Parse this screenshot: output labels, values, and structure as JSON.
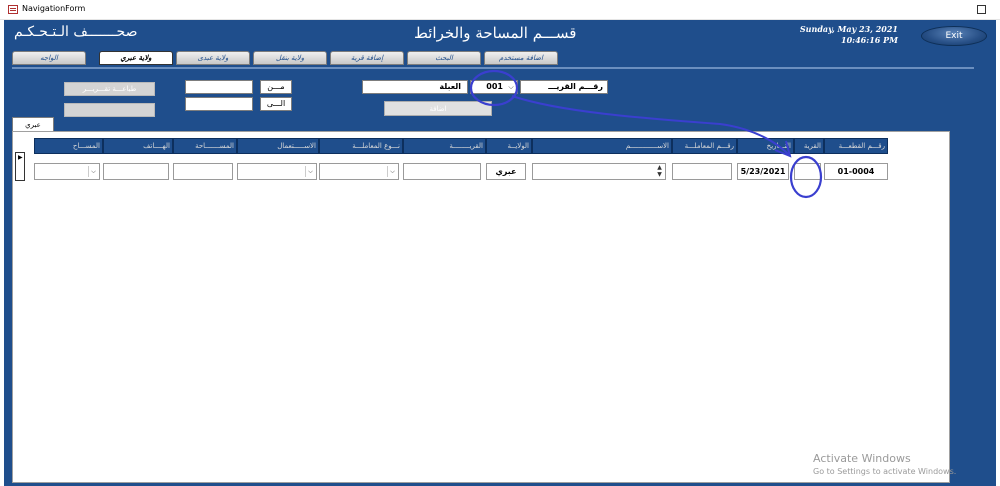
{
  "window": {
    "title": "NavigationForm"
  },
  "header": {
    "main_title": "قســـم المساحة والخرائط",
    "panel_title": "صحـــــــف الـتـحـكـم",
    "date": "Sunday, May 23, 2021",
    "time": "10:46:16 PM",
    "exit_label": "Exit"
  },
  "nav_tabs": [
    {
      "label": "اضافة مستخدم"
    },
    {
      "label": "البحث"
    },
    {
      "label": "إضافة قرية"
    },
    {
      "label": "ولاية بنقل"
    },
    {
      "label": "ولاية عبدى"
    },
    {
      "label": "ولاية عبري",
      "active": true
    },
    {
      "label": "الواجه"
    }
  ],
  "filter": {
    "plot_label": "رقـــم القريـــ",
    "village_code": "001",
    "village_name": "العبلة",
    "from_label": "مـــن",
    "to_label": "الـــى",
    "print_button": "طباعـــة تقـــريـــر",
    "add_button": "اضافة"
  },
  "subform_tab": "عبري",
  "columns": [
    {
      "label": "رقـــم القطعـــة"
    },
    {
      "label": "القرية"
    },
    {
      "label": "التـــاريخ"
    },
    {
      "label": "رقـــم المعاملـــة"
    },
    {
      "label": "الاســـــــــــــم"
    },
    {
      "label": "الولايــة"
    },
    {
      "label": "القريــــــــة"
    },
    {
      "label": "نـــوع المعاملـــة"
    },
    {
      "label": "الاســـــتعمال"
    },
    {
      "label": "المســـــــاحة"
    },
    {
      "label": "الهــــاتف"
    },
    {
      "label": "المســـاح"
    }
  ],
  "row": {
    "plot_number": "01-0004",
    "village": "",
    "date": "5/23/2021",
    "transaction_number": "",
    "name": "",
    "wilayat": "عبري",
    "village_name": "",
    "transaction_type": "",
    "usage": "",
    "area": "",
    "phone": "",
    "surveyor": ""
  },
  "watermark": {
    "line1": "Activate Windows",
    "line2": "Go to Settings to activate Windows."
  },
  "colors": {
    "frame_blue": "#1f4e8c",
    "annotation": "#3a3fcf"
  }
}
